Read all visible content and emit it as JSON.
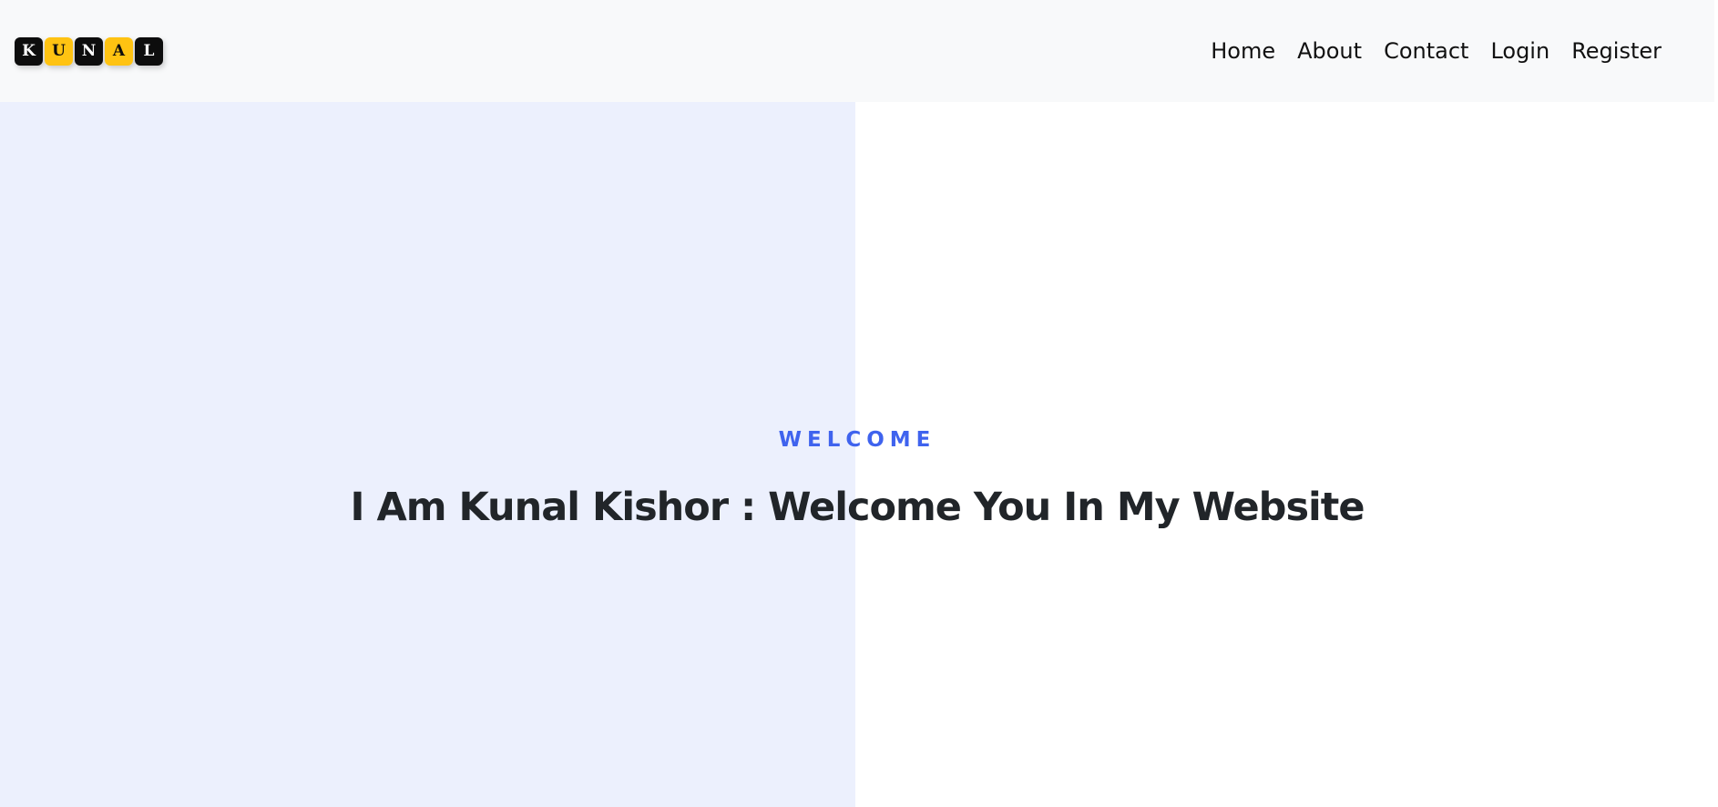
{
  "brand": {
    "logo_letters": [
      "K",
      "U",
      "N",
      "A",
      "L"
    ],
    "tile_colors": [
      "#0d0d0d",
      "#ffc312",
      "#0d0d0d",
      "#ffc312",
      "#0d0d0d"
    ]
  },
  "nav": {
    "links": [
      {
        "label": "Home"
      },
      {
        "label": "About"
      },
      {
        "label": "Contact"
      },
      {
        "label": "Login"
      },
      {
        "label": "Register"
      }
    ]
  },
  "hero": {
    "eyebrow": "WELCOME",
    "headline": "I Am Kunal Kishor : Welcome You In My Website"
  },
  "colors": {
    "navbar_bg": "#f8f9fa",
    "hero_left_bg": "#ecf0fd",
    "accent": "#3f63ee",
    "heading": "#212529"
  }
}
